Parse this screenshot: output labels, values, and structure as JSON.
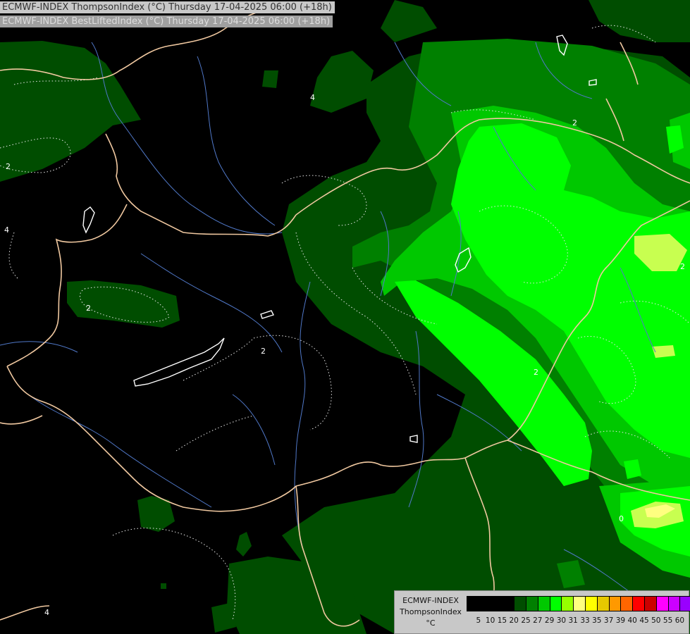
{
  "header": {
    "line1": "ECMWF-INDEX ThompsonIndex (°C) Thursday 17-04-2025 06:00 (+18h)",
    "line2": "ECMWF-INDEX BestLiftedIndex (°C) Thursday 17-04-2025 06:00 (+18h)"
  },
  "legend": {
    "line1": "ECMWF-INDEX",
    "line2": "ThompsonIndex",
    "line3": "°C",
    "levels": [
      "5",
      "10",
      "15",
      "20",
      "25",
      "27",
      "29",
      "30",
      "31",
      "33",
      "35",
      "37",
      "39",
      "40",
      "45",
      "50",
      "55",
      "60"
    ],
    "colors": [
      "#000000",
      "#000000",
      "#000000",
      "#000000",
      "#004d00",
      "#008000",
      "#00c800",
      "#00ff00",
      "#96ff00",
      "#ffff80",
      "#ffff00",
      "#e6c800",
      "#ff9900",
      "#ff6600",
      "#ff0000",
      "#cc0000",
      "#ff00ff",
      "#cc00ff",
      "#9900ff",
      "#6600ff",
      "#0000ff"
    ]
  },
  "contour_labels": [
    "2",
    "2",
    "2",
    "2",
    "2",
    "2",
    "4",
    "4",
    "4",
    "0"
  ],
  "palette": {
    "dark_green": "#004d00",
    "mid_green": "#006b00",
    "green": "#00c800",
    "bright_green": "#00ff00",
    "lime": "#96ff00",
    "yellow_green": "#c8ff50",
    "border": "#f0c8a0",
    "river": "#5078c8",
    "lake": "#ffffff"
  }
}
